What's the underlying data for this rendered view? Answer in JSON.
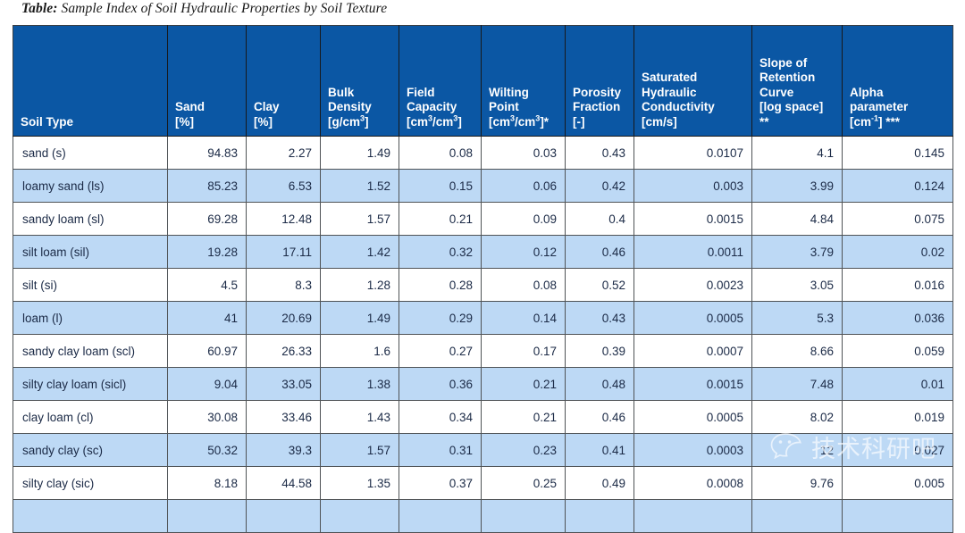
{
  "caption": {
    "lead": "Table:",
    "text": " Sample Index of Soil Hydraulic Properties by Soil Texture"
  },
  "colors": {
    "header_bg": "#0B57A4",
    "header_text": "#ffffff",
    "row_alt_bg": "#bdd9f5",
    "row_bg": "#ffffff",
    "body_text": "#1b2a46",
    "grid_line": "#4f5356"
  },
  "watermark": {
    "label": "技术科研吧",
    "icon": "wechat-icon"
  },
  "table": {
    "headers": [
      {
        "lines": [
          "Soil Type"
        ]
      },
      {
        "lines": [
          "Sand",
          "[%]"
        ]
      },
      {
        "lines": [
          "Clay",
          "[%]"
        ]
      },
      {
        "lines": [
          "Bulk",
          "Density",
          "[g/cm^3]"
        ]
      },
      {
        "lines": [
          "Field",
          "Capacity",
          "[cm^3/cm^3]"
        ]
      },
      {
        "lines": [
          "Wilting",
          "Point",
          "[cm^3/cm^3]*"
        ]
      },
      {
        "lines": [
          "Porosity",
          "Fraction",
          "[-]"
        ]
      },
      {
        "lines": [
          "Saturated",
          "Hydraulic",
          "Conductivity",
          "[cm/s]"
        ]
      },
      {
        "lines": [
          "Slope of",
          "Retention",
          "Curve",
          "[log space]",
          "**"
        ]
      },
      {
        "lines": [
          "Alpha",
          "parameter",
          "[cm^-1] ***"
        ]
      }
    ],
    "rows": [
      {
        "name": "sand (s)",
        "sand": "94.83",
        "clay": "2.27",
        "bulk_density": "1.49",
        "field_capacity": "0.08",
        "wilting_point": "0.03",
        "porosity": "0.43",
        "ksat": "0.0107",
        "slope": "4.1",
        "alpha": "0.145"
      },
      {
        "name": "loamy sand (ls)",
        "sand": "85.23",
        "clay": "6.53",
        "bulk_density": "1.52",
        "field_capacity": "0.15",
        "wilting_point": "0.06",
        "porosity": "0.42",
        "ksat": "0.003",
        "slope": "3.99",
        "alpha": "0.124"
      },
      {
        "name": "sandy loam (sl)",
        "sand": "69.28",
        "clay": "12.48",
        "bulk_density": "1.57",
        "field_capacity": "0.21",
        "wilting_point": "0.09",
        "porosity": "0.4",
        "ksat": "0.0015",
        "slope": "4.84",
        "alpha": "0.075"
      },
      {
        "name": "silt loam (sil)",
        "sand": "19.28",
        "clay": "17.11",
        "bulk_density": "1.42",
        "field_capacity": "0.32",
        "wilting_point": "0.12",
        "porosity": "0.46",
        "ksat": "0.0011",
        "slope": "3.79",
        "alpha": "0.02"
      },
      {
        "name": "silt (si)",
        "sand": "4.5",
        "clay": "8.3",
        "bulk_density": "1.28",
        "field_capacity": "0.28",
        "wilting_point": "0.08",
        "porosity": "0.52",
        "ksat": "0.0023",
        "slope": "3.05",
        "alpha": "0.016"
      },
      {
        "name": "loam (l)",
        "sand": "41",
        "clay": "20.69",
        "bulk_density": "1.49",
        "field_capacity": "0.29",
        "wilting_point": "0.14",
        "porosity": "0.43",
        "ksat": "0.0005",
        "slope": "5.3",
        "alpha": "0.036"
      },
      {
        "name": "sandy clay loam (scl)",
        "sand": "60.97",
        "clay": "26.33",
        "bulk_density": "1.6",
        "field_capacity": "0.27",
        "wilting_point": "0.17",
        "porosity": "0.39",
        "ksat": "0.0007",
        "slope": "8.66",
        "alpha": "0.059"
      },
      {
        "name": "silty clay loam (sicl)",
        "sand": "9.04",
        "clay": "33.05",
        "bulk_density": "1.38",
        "field_capacity": "0.36",
        "wilting_point": "0.21",
        "porosity": "0.48",
        "ksat": "0.0015",
        "slope": "7.48",
        "alpha": "0.01"
      },
      {
        "name": "clay loam (cl)",
        "sand": "30.08",
        "clay": "33.46",
        "bulk_density": "1.43",
        "field_capacity": "0.34",
        "wilting_point": "0.21",
        "porosity": "0.46",
        "ksat": "0.0005",
        "slope": "8.02",
        "alpha": "0.019"
      },
      {
        "name": "sandy clay (sc)",
        "sand": "50.32",
        "clay": "39.3",
        "bulk_density": "1.57",
        "field_capacity": "0.31",
        "wilting_point": "0.23",
        "porosity": "0.41",
        "ksat": "0.0003",
        "slope": "12",
        "alpha": "0.027"
      },
      {
        "name": "silty clay (sic)",
        "sand": "8.18",
        "clay": "44.58",
        "bulk_density": "1.35",
        "field_capacity": "0.37",
        "wilting_point": "0.25",
        "porosity": "0.49",
        "ksat": "0.0008",
        "slope": "9.76",
        "alpha": "0.005"
      },
      {
        "name": "",
        "sand": "",
        "clay": "",
        "bulk_density": "",
        "field_capacity": "",
        "wilting_point": "",
        "porosity": "",
        "ksat": "",
        "slope": "",
        "alpha": ""
      }
    ]
  }
}
